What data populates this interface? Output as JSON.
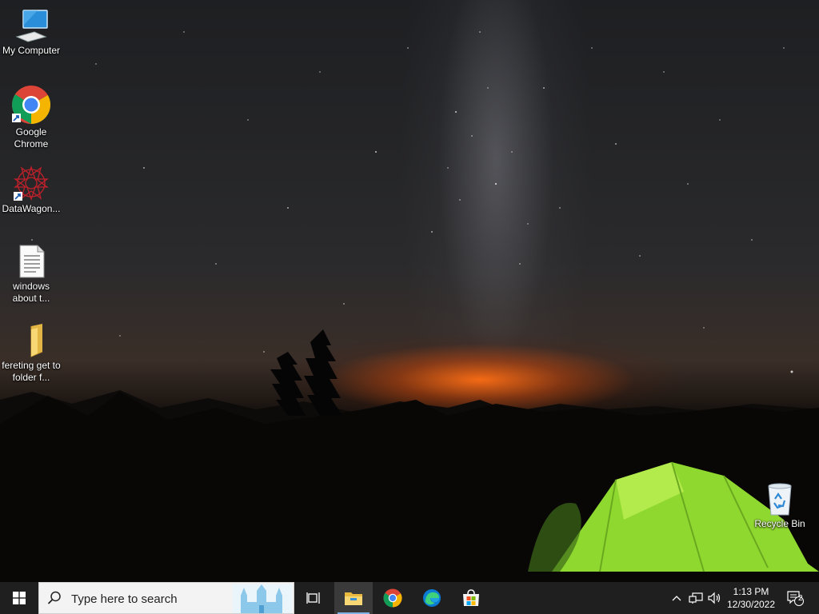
{
  "desktop": {
    "icons": [
      {
        "label": "My Computer",
        "icon": "monitor-icon"
      },
      {
        "label": "Google Chrome",
        "icon": "chrome-icon"
      },
      {
        "label": "DataWagon...",
        "icon": "datawagon-icon"
      },
      {
        "label": "windows about t...",
        "icon": "text-document-icon"
      },
      {
        "label": "fereting get to folder f...",
        "icon": "folder-icon"
      },
      {
        "label": "Recycle Bin",
        "icon": "recycle-bin-icon"
      }
    ]
  },
  "taskbar": {
    "start": {
      "icon": "windows-logo-icon"
    },
    "search": {
      "placeholder": "Type here to search",
      "icon": "search-icon"
    },
    "pinned": [
      {
        "name": "Task View",
        "icon": "task-view-icon"
      },
      {
        "name": "File Explorer",
        "icon": "file-explorer-icon",
        "active": true
      },
      {
        "name": "Google Chrome",
        "icon": "chrome-icon"
      },
      {
        "name": "Microsoft Edge",
        "icon": "edge-icon"
      },
      {
        "name": "Microsoft Store",
        "icon": "store-icon"
      }
    ],
    "tray": {
      "time": "1:13 PM",
      "date": "12/30/2022",
      "notification_count": "2"
    }
  },
  "colors": {
    "taskbar_bg": "#1f1f1f",
    "accent": "#7fb2e5",
    "tent_green": "#9be83a"
  }
}
